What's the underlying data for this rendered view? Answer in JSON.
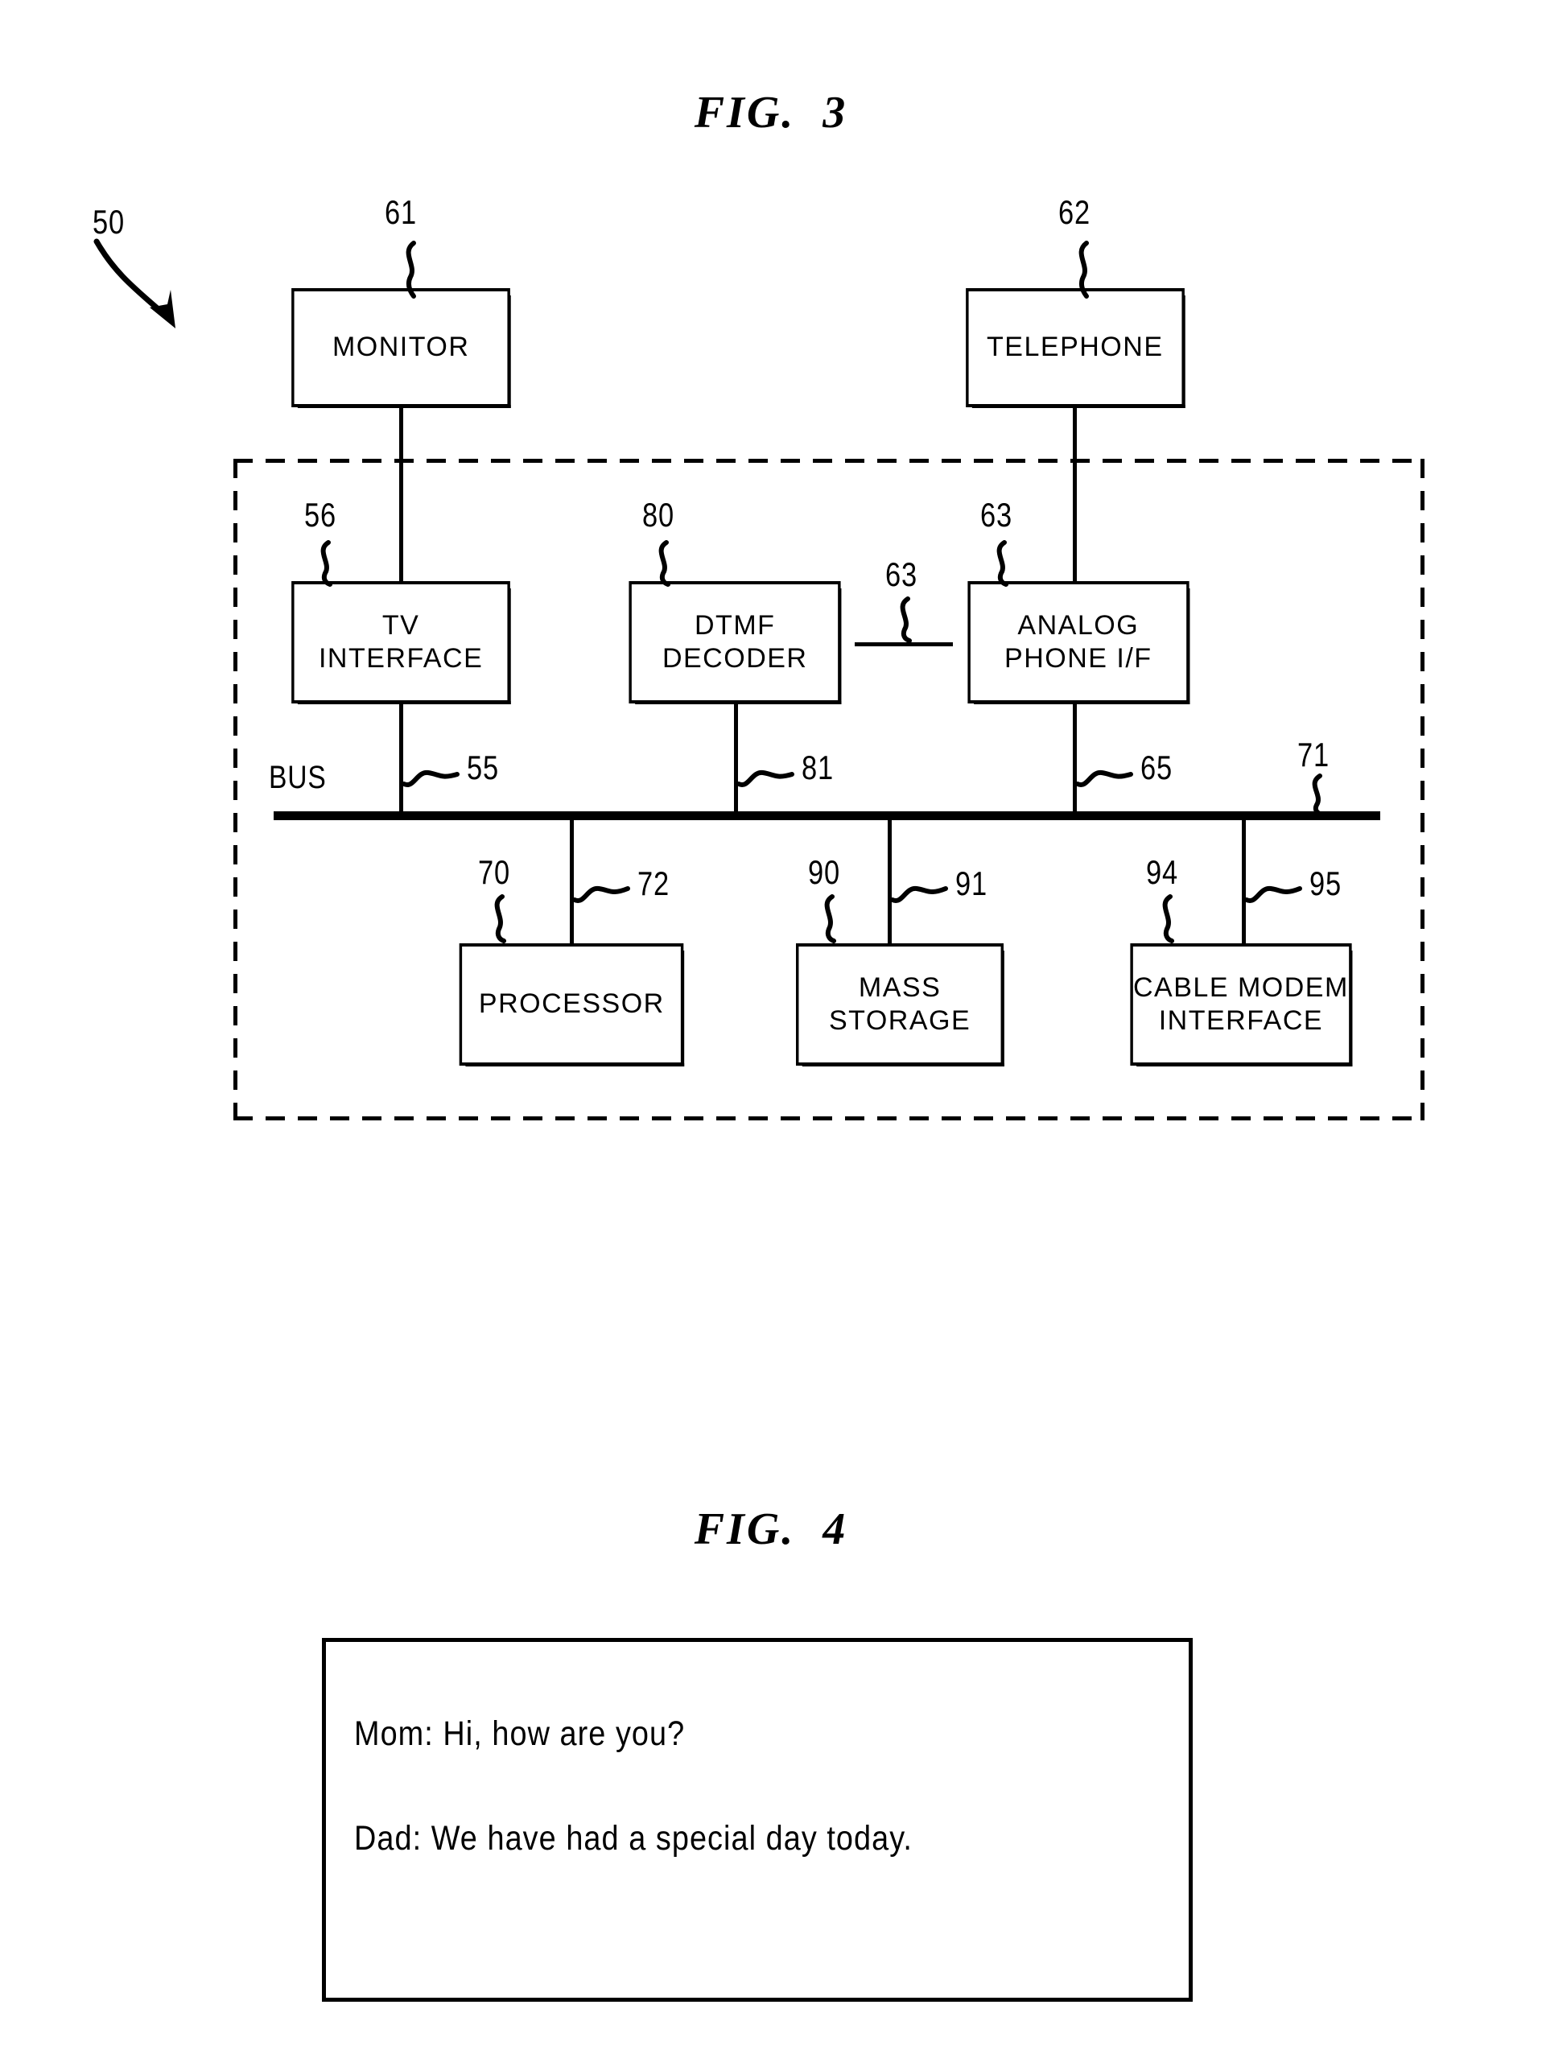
{
  "figures": [
    {
      "id": "fig3",
      "title": "FIG.  3"
    },
    {
      "id": "fig4",
      "title": "FIG.  4"
    }
  ],
  "fig3": {
    "title": "FIG.  3",
    "system_ref": "50",
    "bus_text": "BUS",
    "blocks": {
      "monitor": {
        "label": "MONITOR",
        "ref": "61"
      },
      "telephone": {
        "label": "TELEPHONE",
        "ref": "62"
      },
      "tv_interface": {
        "label": "TV\nINTERFACE",
        "ref": "56"
      },
      "dtmf_decoder": {
        "label": "DTMF\nDECODER",
        "ref": "80"
      },
      "analog_phone_if": {
        "label": "ANALOG\nPHONE I/F",
        "ref": "63"
      },
      "processor": {
        "label": "PROCESSOR",
        "ref": "70"
      },
      "mass_storage": {
        "label": "MASS\nSTORAGE",
        "ref": "90"
      },
      "cable_modem_interface": {
        "label": "CABLE MODEM\nINTERFACE",
        "ref": "94"
      }
    },
    "connection_refs": {
      "dtmf_to_phone": "63",
      "tv_to_bus": "55",
      "dtmf_to_bus": "81",
      "phone_to_bus": "65",
      "bus": "71",
      "processor_to_bus": "72",
      "storage_to_bus": "91",
      "cable_modem_to_bus": "95"
    }
  },
  "fig4": {
    "title": "FIG.  4",
    "dialog": [
      "Mom: Hi, how are you?",
      "Dad: We have had a special day today."
    ]
  }
}
